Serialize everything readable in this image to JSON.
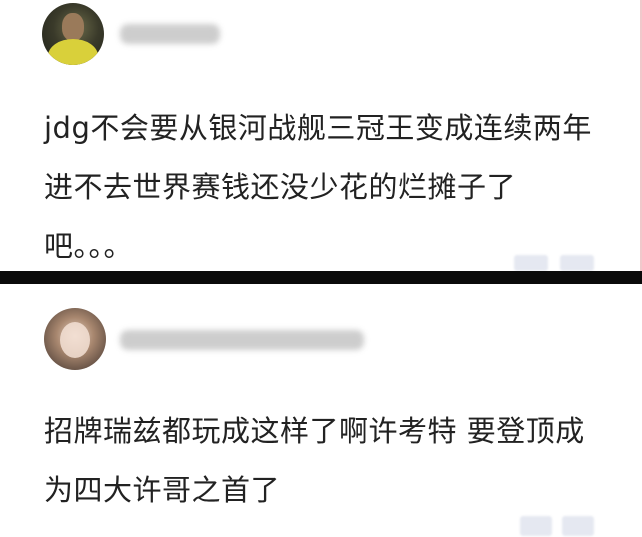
{
  "comments": [
    {
      "text": "jdg不会要从银河战舰三冠王变成连续两年进不去世界赛钱还没少花的烂摊子了吧。。。"
    },
    {
      "text": "招牌瑞兹都玩成这样了啊许考特 要登顶成为四大许哥之首了"
    }
  ],
  "colors": {
    "text": "#222222",
    "divider": "#0a0a0a",
    "background": "#ffffff"
  }
}
